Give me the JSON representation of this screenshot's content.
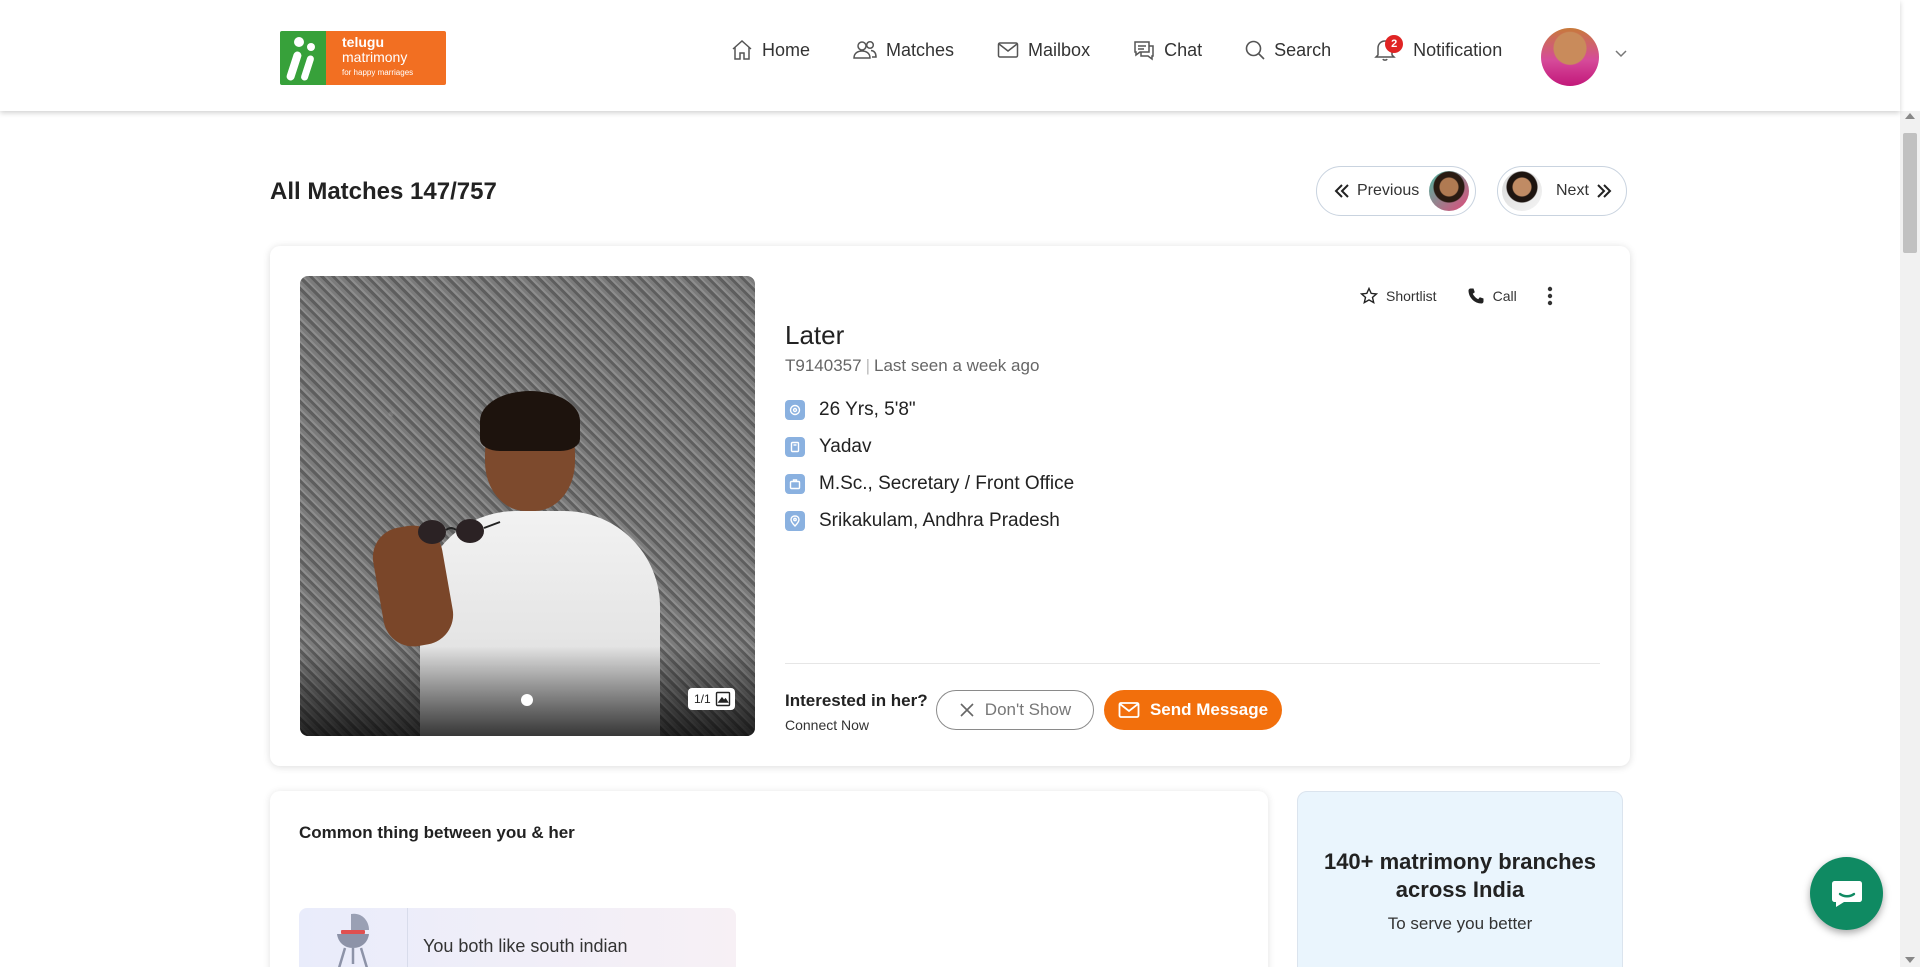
{
  "header": {
    "logo": {
      "line1": "telugu",
      "line2": "matrimony",
      "tagline": "for happy marriages"
    },
    "nav": [
      {
        "label": "Home",
        "icon": "home-icon"
      },
      {
        "label": "Matches",
        "icon": "people-icon"
      },
      {
        "label": "Mailbox",
        "icon": "mail-icon"
      },
      {
        "label": "Chat",
        "icon": "chat-icon"
      },
      {
        "label": "Search",
        "icon": "search-icon"
      },
      {
        "label": "Notification",
        "icon": "bell-icon",
        "badge": "2"
      }
    ]
  },
  "page": {
    "title": "All Matches 147/757",
    "previous_label": "Previous",
    "next_label": "Next"
  },
  "profile": {
    "name": "Later",
    "id": "T9140357",
    "last_seen": "Last seen a week ago",
    "photo_counter": "1/1",
    "facts": {
      "age_height": "26 Yrs, 5'8\"",
      "caste": "Yadav",
      "education_job": "M.Sc., Secretary / Front Office",
      "location": "Srikakulam, Andhra Pradesh"
    },
    "actions": {
      "shortlist": "Shortlist",
      "call": "Call"
    },
    "interest": {
      "question": "Interested in her?",
      "sub": "Connect Now",
      "dont_show": "Don't Show",
      "send_message": "Send Message"
    }
  },
  "common": {
    "title": "Common thing between you & her",
    "item": "You both like south indian"
  },
  "branches": {
    "title": "140+ matrimony branches across India",
    "subtitle": "To serve you better"
  },
  "colors": {
    "brand_orange": "#f26f0c",
    "brand_green": "#37a13a",
    "badge_red": "#e02424",
    "chat_green": "#0f8a62",
    "fact_icon_blue": "#8ab1e0"
  }
}
